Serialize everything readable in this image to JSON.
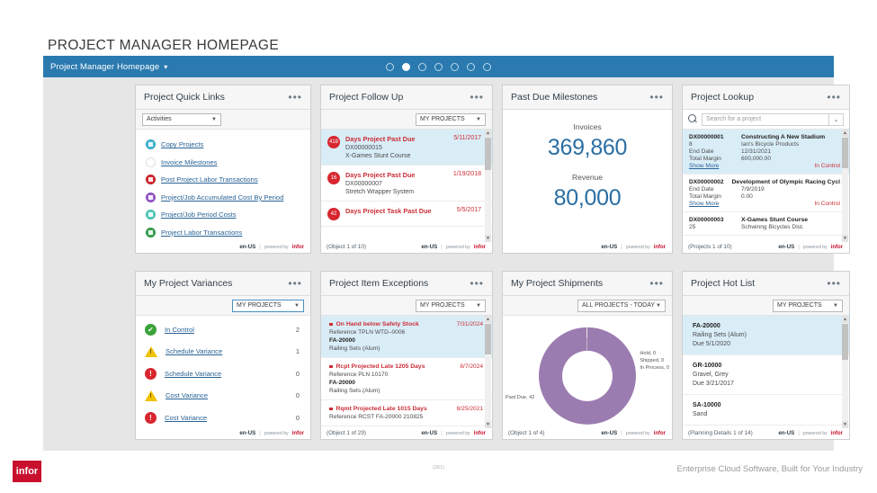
{
  "page": {
    "title": "PROJECT MANAGER HOMEPAGE",
    "page_number": "(261)"
  },
  "appbar": {
    "title": "Project Manager Homepage",
    "caret": "▾",
    "dots_total": 7,
    "dots_active_index": 1
  },
  "footer": {
    "logo": "infor",
    "tagline": "Enterprise Cloud Software, Built for Your Industry"
  },
  "common": {
    "en": "en-US",
    "powered_by": "powered by",
    "brand": "infor",
    "kebab": "•••"
  },
  "cards": {
    "quick_links": {
      "title": "Project Quick Links",
      "filter": "Activities",
      "links": [
        {
          "label": "Copy Projects",
          "icon": "copy-icon",
          "color": "#3fb7d6"
        },
        {
          "label": "Invoice Milestones",
          "icon": "chart-icon",
          "color": "#ffffff"
        },
        {
          "label": "Post Project Labor Transactions",
          "icon": "post-icon",
          "color": "#d8262f"
        },
        {
          "label": "Project/Job Accumulated Cost By Period",
          "icon": "cost-icon",
          "color": "#9b59d0"
        },
        {
          "label": "Project/Job Period Costs",
          "icon": "period-icon",
          "color": "#4fd1c0"
        },
        {
          "label": "Project Labor Transactions",
          "icon": "labor-icon",
          "color": "#36a64f"
        }
      ]
    },
    "follow_up": {
      "title": "Project Follow Up",
      "filter": "MY PROJECTS",
      "count_text": "(Object 1 of 10)",
      "rows": [
        {
          "badge": "418",
          "title": "Days Project Past Due",
          "code": "DX00000015",
          "name": "X-Games Stunt Course",
          "date": "5/11/2017",
          "selected": true
        },
        {
          "badge": "16",
          "title": "Days Project Past Due",
          "code": "DX00000007",
          "name": "Stretch Wrapper System",
          "date": "1/19/2018",
          "selected": false
        },
        {
          "badge": "42",
          "title": "Days Project Task Past Due",
          "code": "",
          "name": "",
          "date": "5/5/2017",
          "selected": false
        }
      ]
    },
    "past_due_milestones": {
      "title": "Past Due Milestones",
      "kpis": [
        {
          "label": "Invoices",
          "value": "369,860"
        },
        {
          "label": "Revenue",
          "value": "80,000"
        }
      ]
    },
    "lookup": {
      "title": "Project Lookup",
      "search_placeholder": "Search for a project",
      "count_text": "(Projects 1 of 10)",
      "rows": [
        {
          "code": "DX00000001",
          "name": "Constructing A New Stadium",
          "num": "8",
          "customer": "Ian's Bicycle Products",
          "end_date_label": "End Date",
          "end_date": "12/31/2021",
          "margin_label": "Total Margin",
          "margin": "600,000.00",
          "show_more": "Show More",
          "status": "In Control",
          "selected": true
        },
        {
          "code": "DX00000002",
          "name": "Development of Olympic Racing Cycl",
          "num": "",
          "customer": "",
          "end_date_label": "End Date",
          "end_date": "7/9/2019",
          "margin_label": "Total Margin",
          "margin": "0.00",
          "show_more": "Show More",
          "status": "In Control",
          "selected": false
        },
        {
          "code": "DX00000003",
          "name": "X-Games Stunt Course",
          "num": "25",
          "customer": "Schwinng Bicycles Dist.",
          "end_date_label": "",
          "end_date": "",
          "margin_label": "",
          "margin": "",
          "show_more": "",
          "status": "",
          "selected": false
        }
      ]
    },
    "variances": {
      "title": "My Project Variances",
      "filter": "MY PROJECTS",
      "rows": [
        {
          "label": "In Control",
          "count": "2",
          "icon": "check-circle-icon",
          "state": "ok"
        },
        {
          "label": "Schedule Variance",
          "count": "1",
          "icon": "warning-triangle-icon",
          "state": "warn"
        },
        {
          "label": "Schedule Variance",
          "count": "0",
          "icon": "error-circle-icon",
          "state": "err"
        },
        {
          "label": "Cost Variance",
          "count": "0",
          "icon": "warning-triangle-icon",
          "state": "warn"
        },
        {
          "label": "Cost Variance",
          "count": "0",
          "icon": "error-circle-icon",
          "state": "err"
        }
      ]
    },
    "item_exceptions": {
      "title": "Project Item Exceptions",
      "filter": "MY PROJECTS",
      "count_text": "(Object 1 of 29)",
      "rows": [
        {
          "title": "On Hand below Safety Stock",
          "date": "7/31/2024",
          "reference": "Reference    TPLN WTD–0006",
          "code": "FA-20000",
          "name": "Railing Sets (Alum)",
          "selected": true
        },
        {
          "title": "Rcpt Projected Late 1205 Days",
          "date": "8/7/2024",
          "reference": "Reference    PLN 10170",
          "code": "FA-20000",
          "name": "Railing Sets (Alum)",
          "selected": false
        },
        {
          "title": "Rqmt Projected Late 1015 Days",
          "date": "8/25/2021",
          "reference": "Reference    RCST FA-20000 210825",
          "code": "",
          "name": "",
          "selected": false
        }
      ]
    },
    "shipments": {
      "title": "My Project Shipments",
      "filter": "ALL PROJECTS - TODAY",
      "count_text": "(Object 1 of 4)",
      "right_labels": "Hold, 0\nShipped, 0\nIn Process, 0",
      "left_label": "Past Due, 42"
    },
    "hot_list": {
      "title": "Project Hot List",
      "filter": "MY PROJECTS",
      "count_text": "(Planning Details 1 of 14)",
      "rows": [
        {
          "code": "FA-20000",
          "name": "Railing Sets (Alum)",
          "due": "Due  5/1/2020",
          "selected": true
        },
        {
          "code": "GR-10000",
          "name": "Gravel, Grey",
          "due": "Due  3/21/2017",
          "selected": false
        },
        {
          "code": "SA-10000",
          "name": "Sand",
          "due": "",
          "selected": false
        }
      ]
    }
  },
  "chart_data": {
    "type": "pie",
    "title": "My Project Shipments",
    "categories": [
      "Past Due",
      "Hold",
      "Shipped",
      "In Process"
    ],
    "values": [
      42,
      0,
      0,
      0
    ],
    "colors": [
      "#9b7cb0",
      "#e8e8e8",
      "#e8e8e8",
      "#e8e8e8"
    ],
    "legend_position": "callout-labels",
    "donut": true
  }
}
